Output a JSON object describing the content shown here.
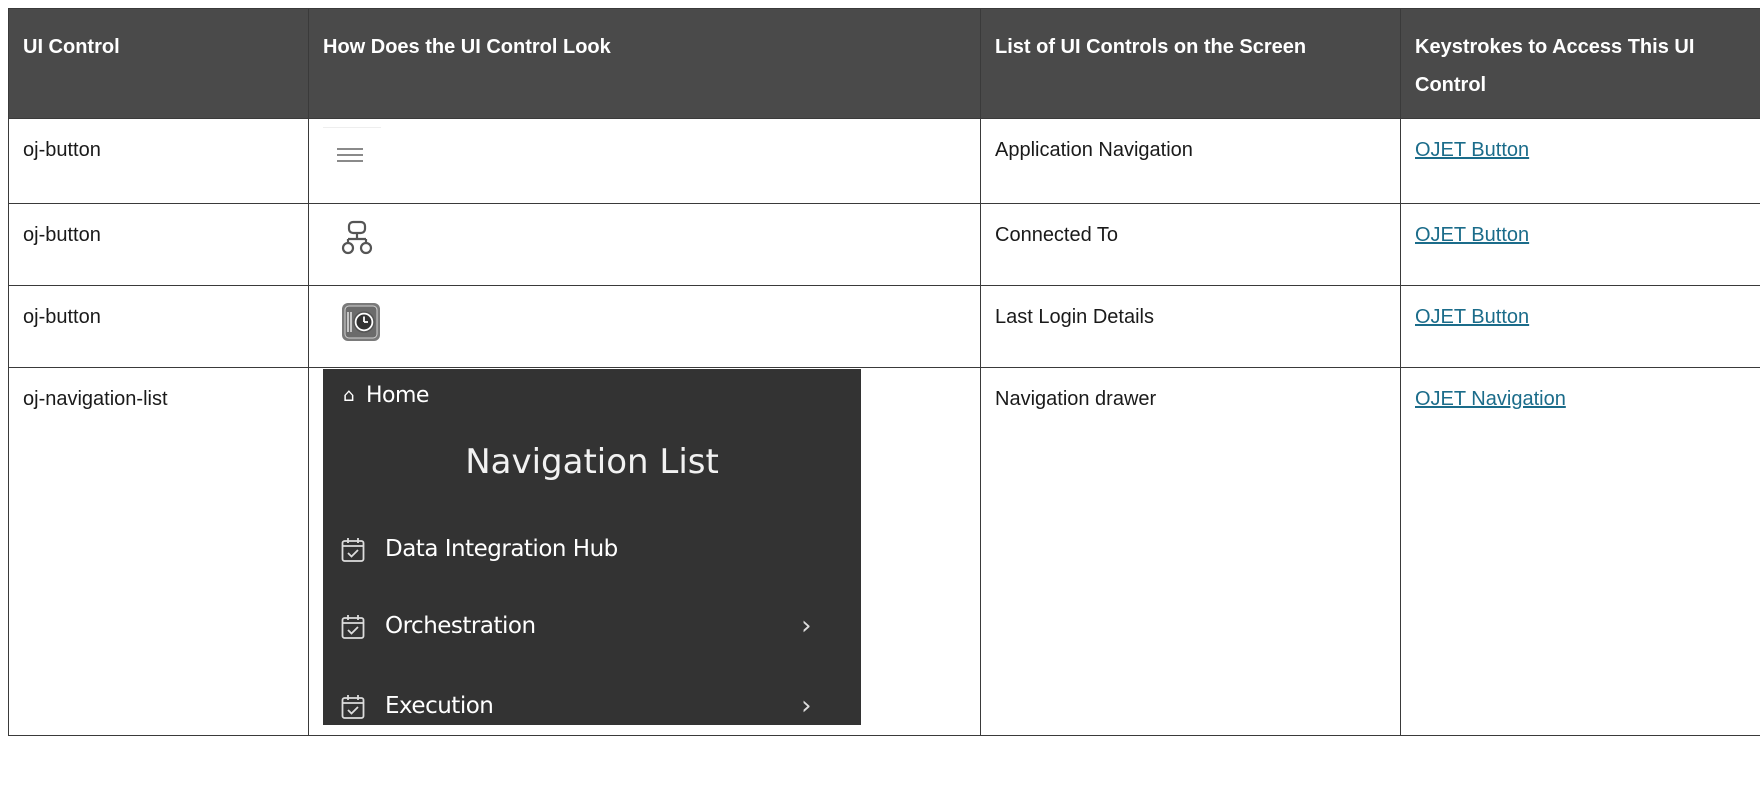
{
  "table": {
    "headers": [
      "UI Control",
      "How Does the UI Control Look",
      "List of UI Controls on the Screen",
      "Keystrokes to Access This UI Control"
    ],
    "rows": [
      {
        "control": "oj-button",
        "look_icon": "hamburger-menu-icon",
        "screen_control": "Application Navigation",
        "keystroke_link": "OJET Button"
      },
      {
        "control": "oj-button",
        "look_icon": "hierarchy-network-icon",
        "screen_control": "Connected To",
        "keystroke_link": "OJET Button"
      },
      {
        "control": "oj-button",
        "look_icon": "clock-login-icon",
        "screen_control": "Last Login Details",
        "keystroke_link": "OJET Button"
      },
      {
        "control": "oj-navigation-list",
        "look_icon": "navigation-drawer-preview",
        "screen_control": "Navigation drawer",
        "keystroke_link": "OJET Navigation"
      }
    ]
  },
  "nav_preview": {
    "home_label": "Home",
    "title": "Navigation List",
    "items": [
      {
        "label": "Data Integration Hub",
        "has_chevron": false
      },
      {
        "label": "Orchestration",
        "has_chevron": true
      },
      {
        "label": "Execution",
        "has_chevron": true
      }
    ]
  },
  "colors": {
    "header_bg": "#4a4a4a",
    "link": "#1b6c8a",
    "drawer_bg": "#333333"
  }
}
